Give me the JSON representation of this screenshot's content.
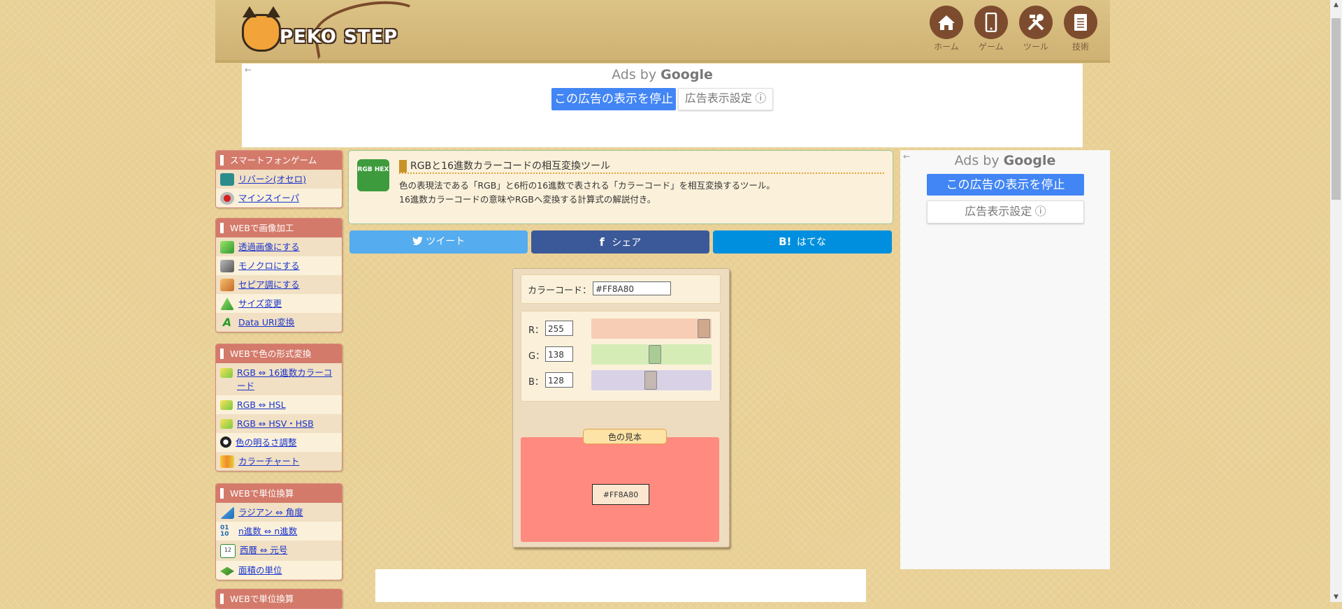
{
  "header": {
    "logo_text": "PEKO STEP",
    "nav": [
      {
        "label": "ホーム",
        "icon": "home-icon"
      },
      {
        "label": "ゲーム",
        "icon": "smartphone-icon"
      },
      {
        "label": "ツール",
        "icon": "tools-icon"
      },
      {
        "label": "技術",
        "icon": "document-icon"
      }
    ]
  },
  "ads": {
    "top": {
      "ads_by": "Ads by",
      "google": "Google",
      "stop_button": "この広告の表示を停止",
      "settings_button": "広告表示設定 ⓘ"
    },
    "side": {
      "ads_by": "Ads by",
      "google": "Google",
      "stop_button": "この広告の表示を停止",
      "settings_button": "広告表示設定 ⓘ"
    }
  },
  "sidebar": [
    {
      "heading": "スマートフォンゲーム",
      "items": [
        {
          "label": "リバーシ(オセロ)",
          "icon": "reversi-icon"
        },
        {
          "label": "マインスイーパ",
          "icon": "mine-icon"
        }
      ]
    },
    {
      "heading": "WEBで画像加工",
      "items": [
        {
          "label": "透過画像にする",
          "icon": "cube-green-icon"
        },
        {
          "label": "モノクロにする",
          "icon": "cube-gray-icon"
        },
        {
          "label": "セピア調にする",
          "icon": "cube-orange-icon"
        },
        {
          "label": "サイズ変更",
          "icon": "pyramid-icon"
        },
        {
          "label": "Data URI変換",
          "icon": "data-uri-icon"
        }
      ]
    },
    {
      "heading": "WEBで色の形式変換",
      "items": [
        {
          "label": "RGB ⇔ 16進数カラーコード",
          "icon": "color-cube-icon"
        },
        {
          "label": "RGB ⇔ HSL",
          "icon": "color-cube-icon"
        },
        {
          "label": "RGB ⇔ HSV・HSB",
          "icon": "color-cube-icon"
        },
        {
          "label": "色の明るさ調整",
          "icon": "brightness-icon"
        },
        {
          "label": "カラーチャート",
          "icon": "color-chart-icon"
        }
      ]
    },
    {
      "heading": "WEBで単位換算",
      "items": [
        {
          "label": "ラジアン ⇔ 角度",
          "icon": "triangle-ruler-icon"
        },
        {
          "label": "n進数 ⇔ n進数",
          "icon": "binary-icon"
        },
        {
          "label": "西暦 ⇔ 元号",
          "icon": "calendar-icon"
        },
        {
          "label": "面積の単位",
          "icon": "area-icon"
        }
      ]
    },
    {
      "heading": "WEBで単位換算",
      "items": []
    }
  ],
  "intro": {
    "icon_text": "RGB HEX",
    "title": "RGBと16進数カラーコードの相互変換ツール",
    "desc_line1": "色の表現法である「RGB」と6桁の16進数で表される「カラーコード」を相互変換するツール。",
    "desc_line2": "16進数カラーコードの意味やRGBへ変換する計算式の解説付き。"
  },
  "share": {
    "tweet": "ツイート",
    "share": "シェア",
    "hatena": "はてな",
    "hatena_mark": "B!",
    "facebook_mark": "f"
  },
  "tool": {
    "code_label": "カラーコード：",
    "code_value": "#FF8A80",
    "rgb": [
      {
        "label": "R：",
        "value": "255",
        "fraction": 1.0,
        "track_color": "#f8cdb5",
        "thumb_color": "#d0a88c"
      },
      {
        "label": "G：",
        "value": "138",
        "fraction": 0.541,
        "track_color": "#d6ecb7",
        "thumb_color": "#a9cb94"
      },
      {
        "label": "B：",
        "value": "128",
        "fraction": 0.502,
        "track_color": "#d9d2e7",
        "thumb_color": "#c3b8b2"
      }
    ],
    "sample_label": "色の見本",
    "sample_color": "#ff8a80",
    "sample_code": "#FF8A80"
  },
  "colors": {
    "tweet": "#55acee",
    "facebook": "#3b5998",
    "hatena": "#008fde"
  }
}
